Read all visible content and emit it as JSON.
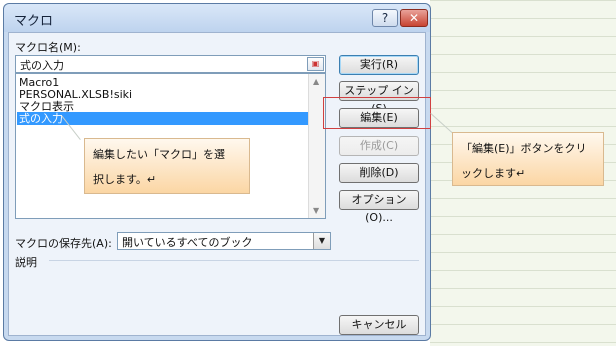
{
  "dialog": {
    "title": "マクロ",
    "help_label": "?",
    "close_label": "✕"
  },
  "macro_name": {
    "label": "マクロ名(M):",
    "value": "式の入力",
    "picker_icon": "range-picker-icon"
  },
  "macro_list": {
    "items": [
      "Macro1",
      "PERSONAL.XLSB!siki",
      "マクロ表示",
      "式の入力"
    ],
    "selected": "式の入力"
  },
  "buttons": {
    "run": "実行(R)",
    "step_in": "ステップ イン(S)",
    "edit": "編集(E)",
    "create": "作成(C)",
    "delete": "削除(D)",
    "options": "オプション(O)...",
    "cancel": "キャンセル"
  },
  "store_in": {
    "label": "マクロの保存先(A):",
    "value": "開いているすべてのブック"
  },
  "description": {
    "label": "説明"
  },
  "callouts": {
    "select_macro": {
      "line1": "編集したい「マクロ」を選",
      "line2": "択します。↵"
    },
    "edit_button": {
      "line1": "「編集(E)」ボタンをクリ",
      "line2": "ックします↵"
    }
  },
  "colors": {
    "highlight": "#d04040",
    "selection": "#3399ff",
    "callout_fill": "#fbd6a4"
  }
}
